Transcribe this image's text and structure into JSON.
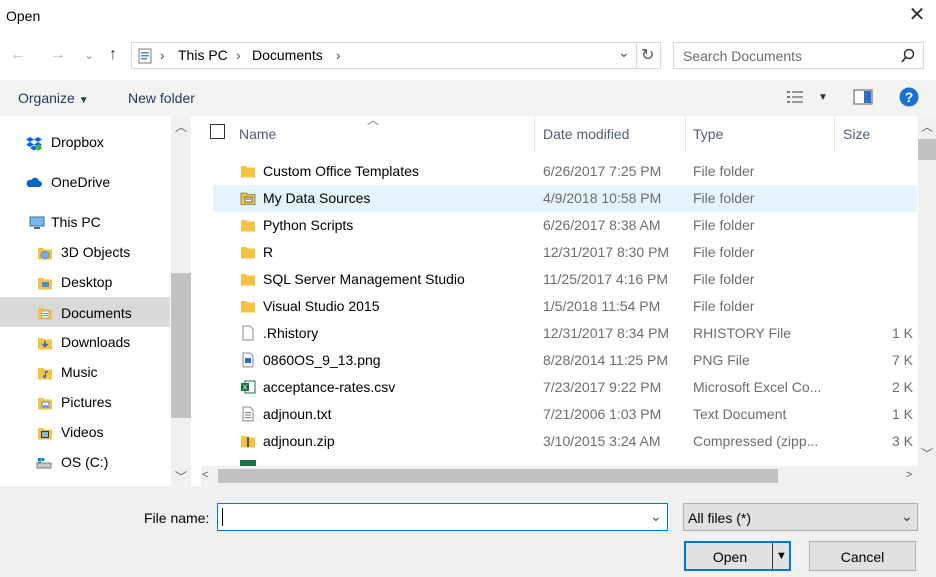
{
  "window": {
    "title": "Open",
    "close": "✕"
  },
  "nav": {
    "back": "←",
    "forward": "→",
    "recent": "⌄",
    "up": "↑"
  },
  "address": {
    "crumbs": [
      "This PC",
      "Documents"
    ],
    "sep": "›",
    "dropdown": "⌄",
    "refresh": "↻"
  },
  "search": {
    "placeholder": "Search Documents"
  },
  "toolbar": {
    "organize": "Organize",
    "new_folder": "New folder",
    "help": "?"
  },
  "sidebar": {
    "items": [
      {
        "label": "Dropbox"
      },
      {
        "label": "OneDrive"
      },
      {
        "label": "This PC"
      },
      {
        "label": "3D Objects"
      },
      {
        "label": "Desktop"
      },
      {
        "label": "Documents"
      },
      {
        "label": "Downloads"
      },
      {
        "label": "Music"
      },
      {
        "label": "Pictures"
      },
      {
        "label": "Videos"
      },
      {
        "label": "OS (C:)"
      }
    ]
  },
  "columns": {
    "name": "Name",
    "date": "Date modified",
    "type": "Type",
    "size": "Size"
  },
  "files": [
    {
      "name": "Custom Office Templates",
      "date": "6/26/2017 7:25 PM",
      "type": "File folder",
      "size": "",
      "kind": "folder"
    },
    {
      "name": "My Data Sources",
      "date": "4/9/2018 10:58 PM",
      "type": "File folder",
      "size": "",
      "kind": "datafolder"
    },
    {
      "name": "Python Scripts",
      "date": "6/26/2017 8:38 AM",
      "type": "File folder",
      "size": "",
      "kind": "folder"
    },
    {
      "name": "R",
      "date": "12/31/2017 8:30 PM",
      "type": "File folder",
      "size": "",
      "kind": "folder"
    },
    {
      "name": "SQL Server Management Studio",
      "date": "11/25/2017 4:16 PM",
      "type": "File folder",
      "size": "",
      "kind": "folder"
    },
    {
      "name": "Visual Studio 2015",
      "date": "1/5/2018 11:54 PM",
      "type": "File folder",
      "size": "",
      "kind": "folder"
    },
    {
      "name": ".Rhistory",
      "date": "12/31/2017 8:34 PM",
      "type": "RHISTORY File",
      "size": "1 K",
      "kind": "file"
    },
    {
      "name": "0860OS_9_13.png",
      "date": "8/28/2014 11:25 PM",
      "type": "PNG File",
      "size": "7 K",
      "kind": "image"
    },
    {
      "name": "acceptance-rates.csv",
      "date": "7/23/2017 9:22 PM",
      "type": "Microsoft Excel Co...",
      "size": "2 K",
      "kind": "excel"
    },
    {
      "name": "adjnoun.txt",
      "date": "7/21/2006 1:03 PM",
      "type": "Text Document",
      "size": "1 K",
      "kind": "text"
    },
    {
      "name": "adjnoun.zip",
      "date": "3/10/2015 3:24 AM",
      "type": "Compressed (zipp...",
      "size": "3 K",
      "kind": "zip"
    }
  ],
  "bottom": {
    "file_name_label": "File name:",
    "file_name_value": "",
    "filter": "All files (*)",
    "open": "Open",
    "cancel": "Cancel"
  },
  "colors": {
    "accent": "#0078d7",
    "folder": "#f5c242",
    "selected_row": "#e5f3fb",
    "selected_nav": "#d9d9d9"
  }
}
